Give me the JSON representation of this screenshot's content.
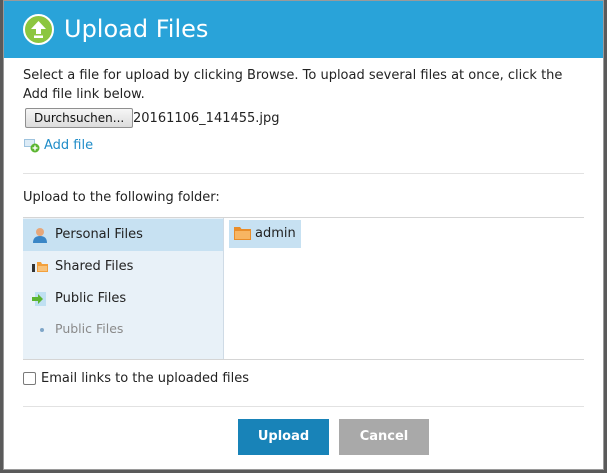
{
  "dialog": {
    "title": "Upload Files",
    "instructions": "Select a file for upload by clicking Browse. To upload several files at once, click the Add file link below.",
    "browse_label": "Durchsuchen...",
    "selected_file": "20161106_141455.jpg",
    "add_file_label": "Add file",
    "folder_heading": "Upload to the following folder:",
    "nav": {
      "personal": "Personal Files",
      "shared": "Shared Files",
      "public": "Public Files",
      "public_sub": "Public Files"
    },
    "folders": [
      {
        "name": "admin",
        "icon": "folder-icon",
        "selected": true
      }
    ],
    "email_label": "Email links to the uploaded files",
    "email_checked": false,
    "upload_label": "Upload",
    "cancel_label": "Cancel"
  },
  "colors": {
    "header": "#29a3d9",
    "header_icon": "#8cc63f",
    "link": "#1f8cc8",
    "upload_button": "#1883b8",
    "cancel_button": "#a9a9a9",
    "selection": "#c7e1f2"
  }
}
